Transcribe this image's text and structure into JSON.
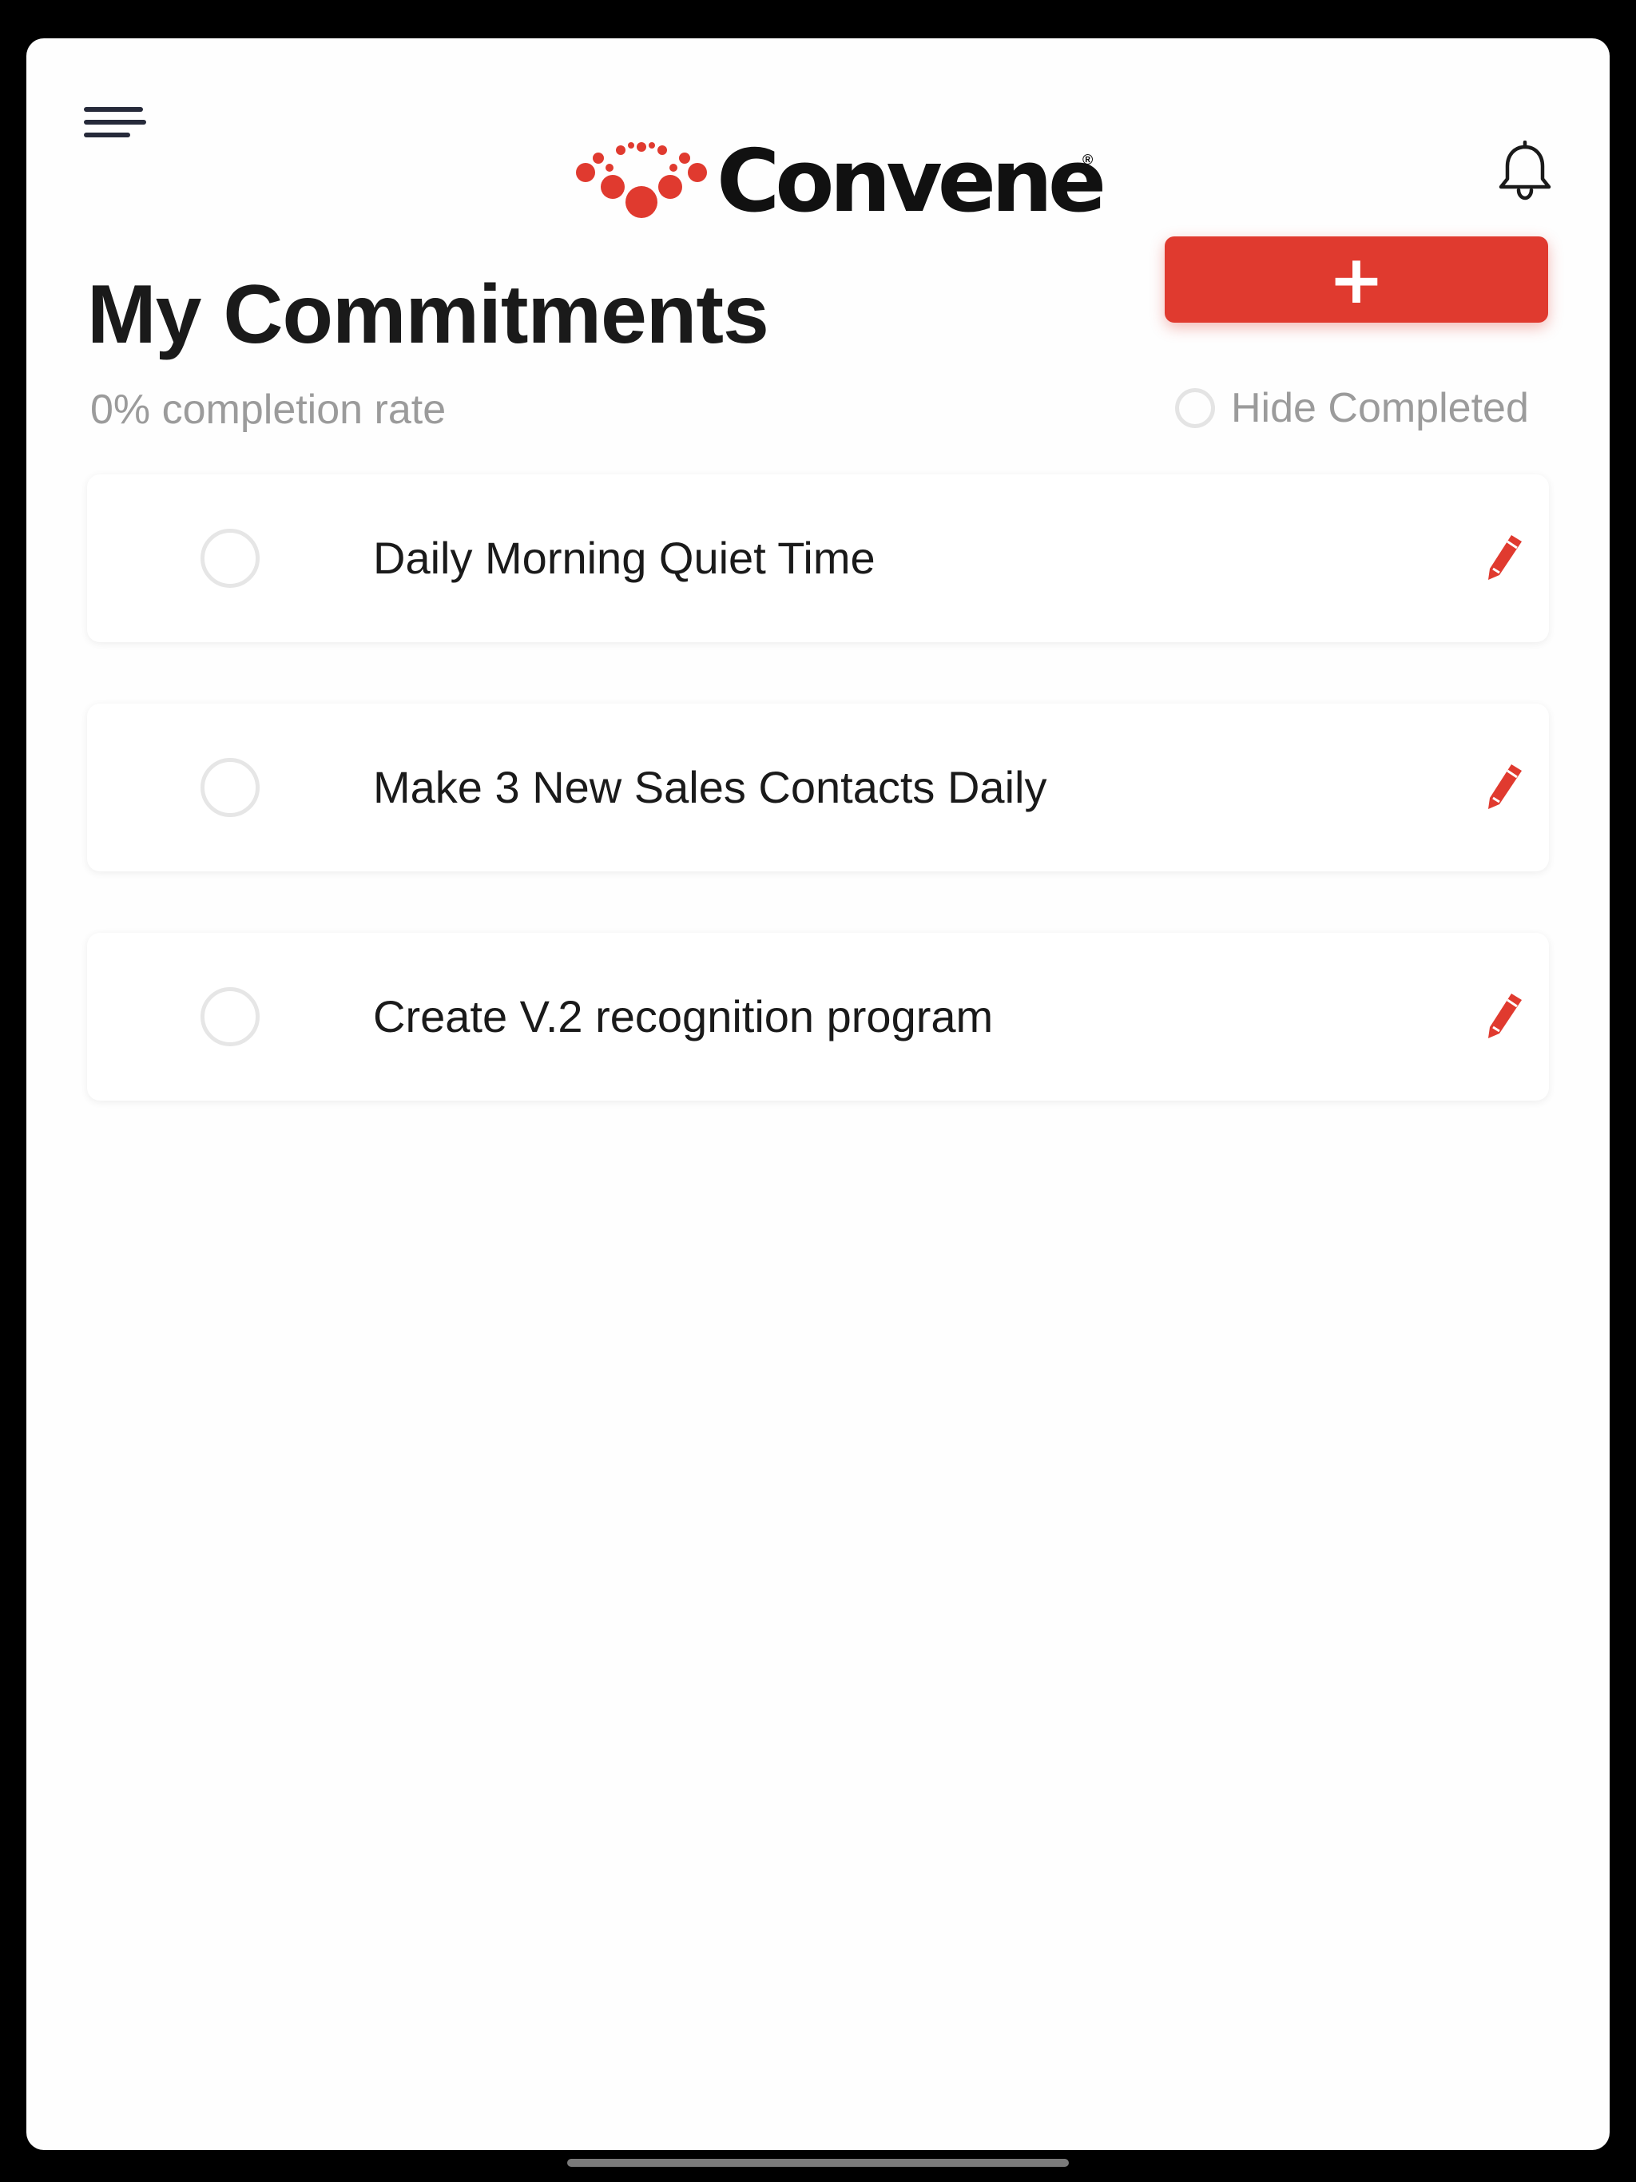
{
  "header": {
    "logo_text": "Convene",
    "logo_reg": "®",
    "menu_icon": "hamburger-menu-icon",
    "bell_icon": "bell-icon"
  },
  "page": {
    "title": "My Commitments",
    "add_label": "+",
    "completion_rate": "0% completion rate",
    "hide_completed_label": "Hide Completed"
  },
  "commitments": [
    {
      "label": "Daily Morning Quiet Time"
    },
    {
      "label": "Make 3 New Sales Contacts Daily"
    },
    {
      "label": "Create V.2 recognition program"
    }
  ],
  "colors": {
    "accent": "#e03a2f",
    "text": "#1a1a1a",
    "muted": "#9b9b9b"
  }
}
